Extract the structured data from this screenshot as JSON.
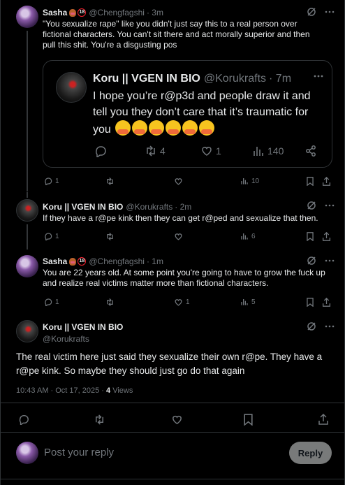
{
  "tweet1": {
    "name": "Sasha",
    "age_badge": "18",
    "handle": "@Chengfagshi",
    "time": "· 3m",
    "text": "\"You sexualize rape\" like you didn't just say this to a real person over fictional characters.  You can't sit there and act morally superior and then pull this shit. You're a disgusting pos",
    "actions": {
      "replies": "1",
      "retweets": "",
      "likes": "",
      "views": "10"
    }
  },
  "quote": {
    "name": "Koru || VGEN IN BIO",
    "handle": "@Korukrafts",
    "time": "· 7m",
    "text": "I hope you’re r@p3d and people draw it and tell you they don’t care that it’s traumatic for you",
    "actions": {
      "replies": "",
      "retweets": "4",
      "likes": "1",
      "views": "140"
    }
  },
  "tweet2": {
    "name": "Koru || VGEN IN BIO",
    "handle": "@Korukrafts",
    "time": "· 2m",
    "text": "If they have a r@pe kink then they can get r@ped and sexualize that then.",
    "actions": {
      "replies": "1",
      "retweets": "",
      "likes": "",
      "views": "6"
    }
  },
  "tweet3": {
    "name": "Sasha",
    "age_badge": "18",
    "handle": "@Chengfagshi",
    "time": "· 1m",
    "text": "You are 22 years old. At some point you're going to have to grow the fuck up and realize real victims matter more than fictional characters.",
    "actions": {
      "replies": "1",
      "retweets": "",
      "likes": "1",
      "views": "5"
    }
  },
  "main": {
    "name": "Koru || VGEN IN BIO",
    "handle": "@Korukrafts",
    "text": "The real victim here just said they sexualize their own r@pe. They have a r@pe kink. So maybe they should just go do that again",
    "timestamp": "10:43 AM · Oct 17, 2025 · ",
    "views_count": "4",
    "views_label": "Views"
  },
  "composer": {
    "placeholder": "Post your reply",
    "reply_label": "Reply"
  },
  "colors": {
    "background": "#000000",
    "text": "#e7e9ea",
    "muted": "#71767b",
    "border": "#2f3336",
    "reply_button": "#787a7a"
  }
}
